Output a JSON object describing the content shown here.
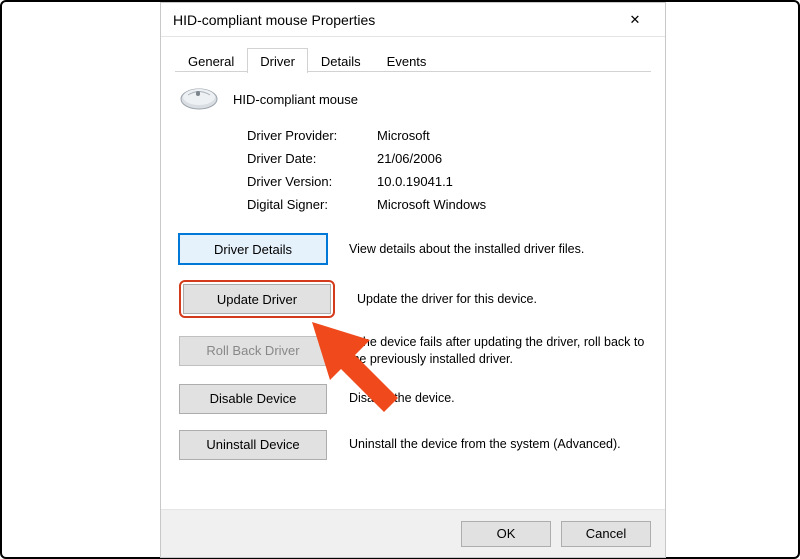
{
  "window": {
    "title": "HID-compliant mouse Properties",
    "close_glyph": "✕"
  },
  "tabs": [
    {
      "label": "General"
    },
    {
      "label": "Driver"
    },
    {
      "label": "Details"
    },
    {
      "label": "Events"
    }
  ],
  "device": {
    "name": "HID-compliant mouse"
  },
  "info": [
    {
      "label": "Driver Provider:",
      "value": "Microsoft"
    },
    {
      "label": "Driver Date:",
      "value": "21/06/2006"
    },
    {
      "label": "Driver Version:",
      "value": "10.0.19041.1"
    },
    {
      "label": "Digital Signer:",
      "value": "Microsoft Windows"
    }
  ],
  "buttons": {
    "details": {
      "label": "Driver Details",
      "desc": "View details about the installed driver files."
    },
    "update": {
      "label": "Update Driver",
      "desc": "Update the driver for this device."
    },
    "rollback": {
      "label": "Roll Back Driver",
      "desc": "If the device fails after updating the driver, roll back to the previously installed driver."
    },
    "disable": {
      "label": "Disable Device",
      "desc": "Disable the device."
    },
    "uninstall": {
      "label": "Uninstall Device",
      "desc": "Uninstall the device from the system (Advanced)."
    }
  },
  "footer": {
    "ok": "OK",
    "cancel": "Cancel"
  },
  "annotation": {
    "arrow_color": "#f04a1c"
  }
}
